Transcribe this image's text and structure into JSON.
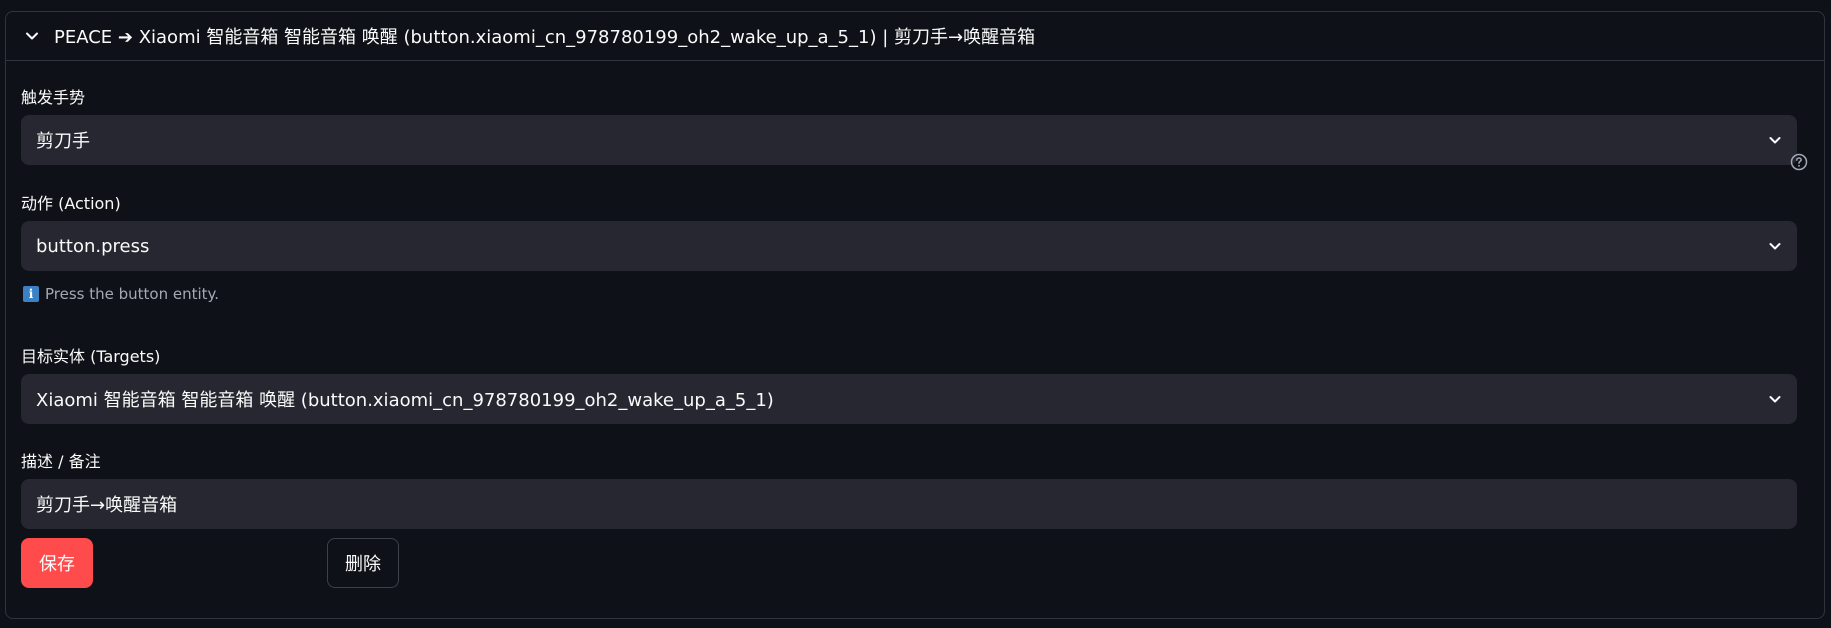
{
  "expander": {
    "title": "PEACE ➔ Xiaomi 智能音箱 智能音箱 唤醒 (button.xiaomi_cn_978780199_oh2_wake_up_a_5_1) | 剪刀手→唤醒音箱",
    "expanded_icon": "chevron-down-icon"
  },
  "gesture": {
    "label": "触发手势",
    "selected": "剪刀手"
  },
  "action": {
    "label": "动作 (Action)",
    "selected": "button.press",
    "help_icon": "question-circle-icon",
    "caption": "Press the button entity."
  },
  "targets": {
    "label": "目标实体 (Targets)",
    "selected": "Xiaomi 智能音箱 智能音箱 唤醒 (button.xiaomi_cn_978780199_oh2_wake_up_a_5_1)"
  },
  "description": {
    "label": "描述 / 备注",
    "value": "剪刀手→唤醒音箱"
  },
  "buttons": {
    "save": "保存",
    "delete": "删除"
  },
  "colors": {
    "background": "#0e1117",
    "input_bg": "#262730",
    "primary": "#ff4b4b",
    "info": "#3b82c4"
  }
}
